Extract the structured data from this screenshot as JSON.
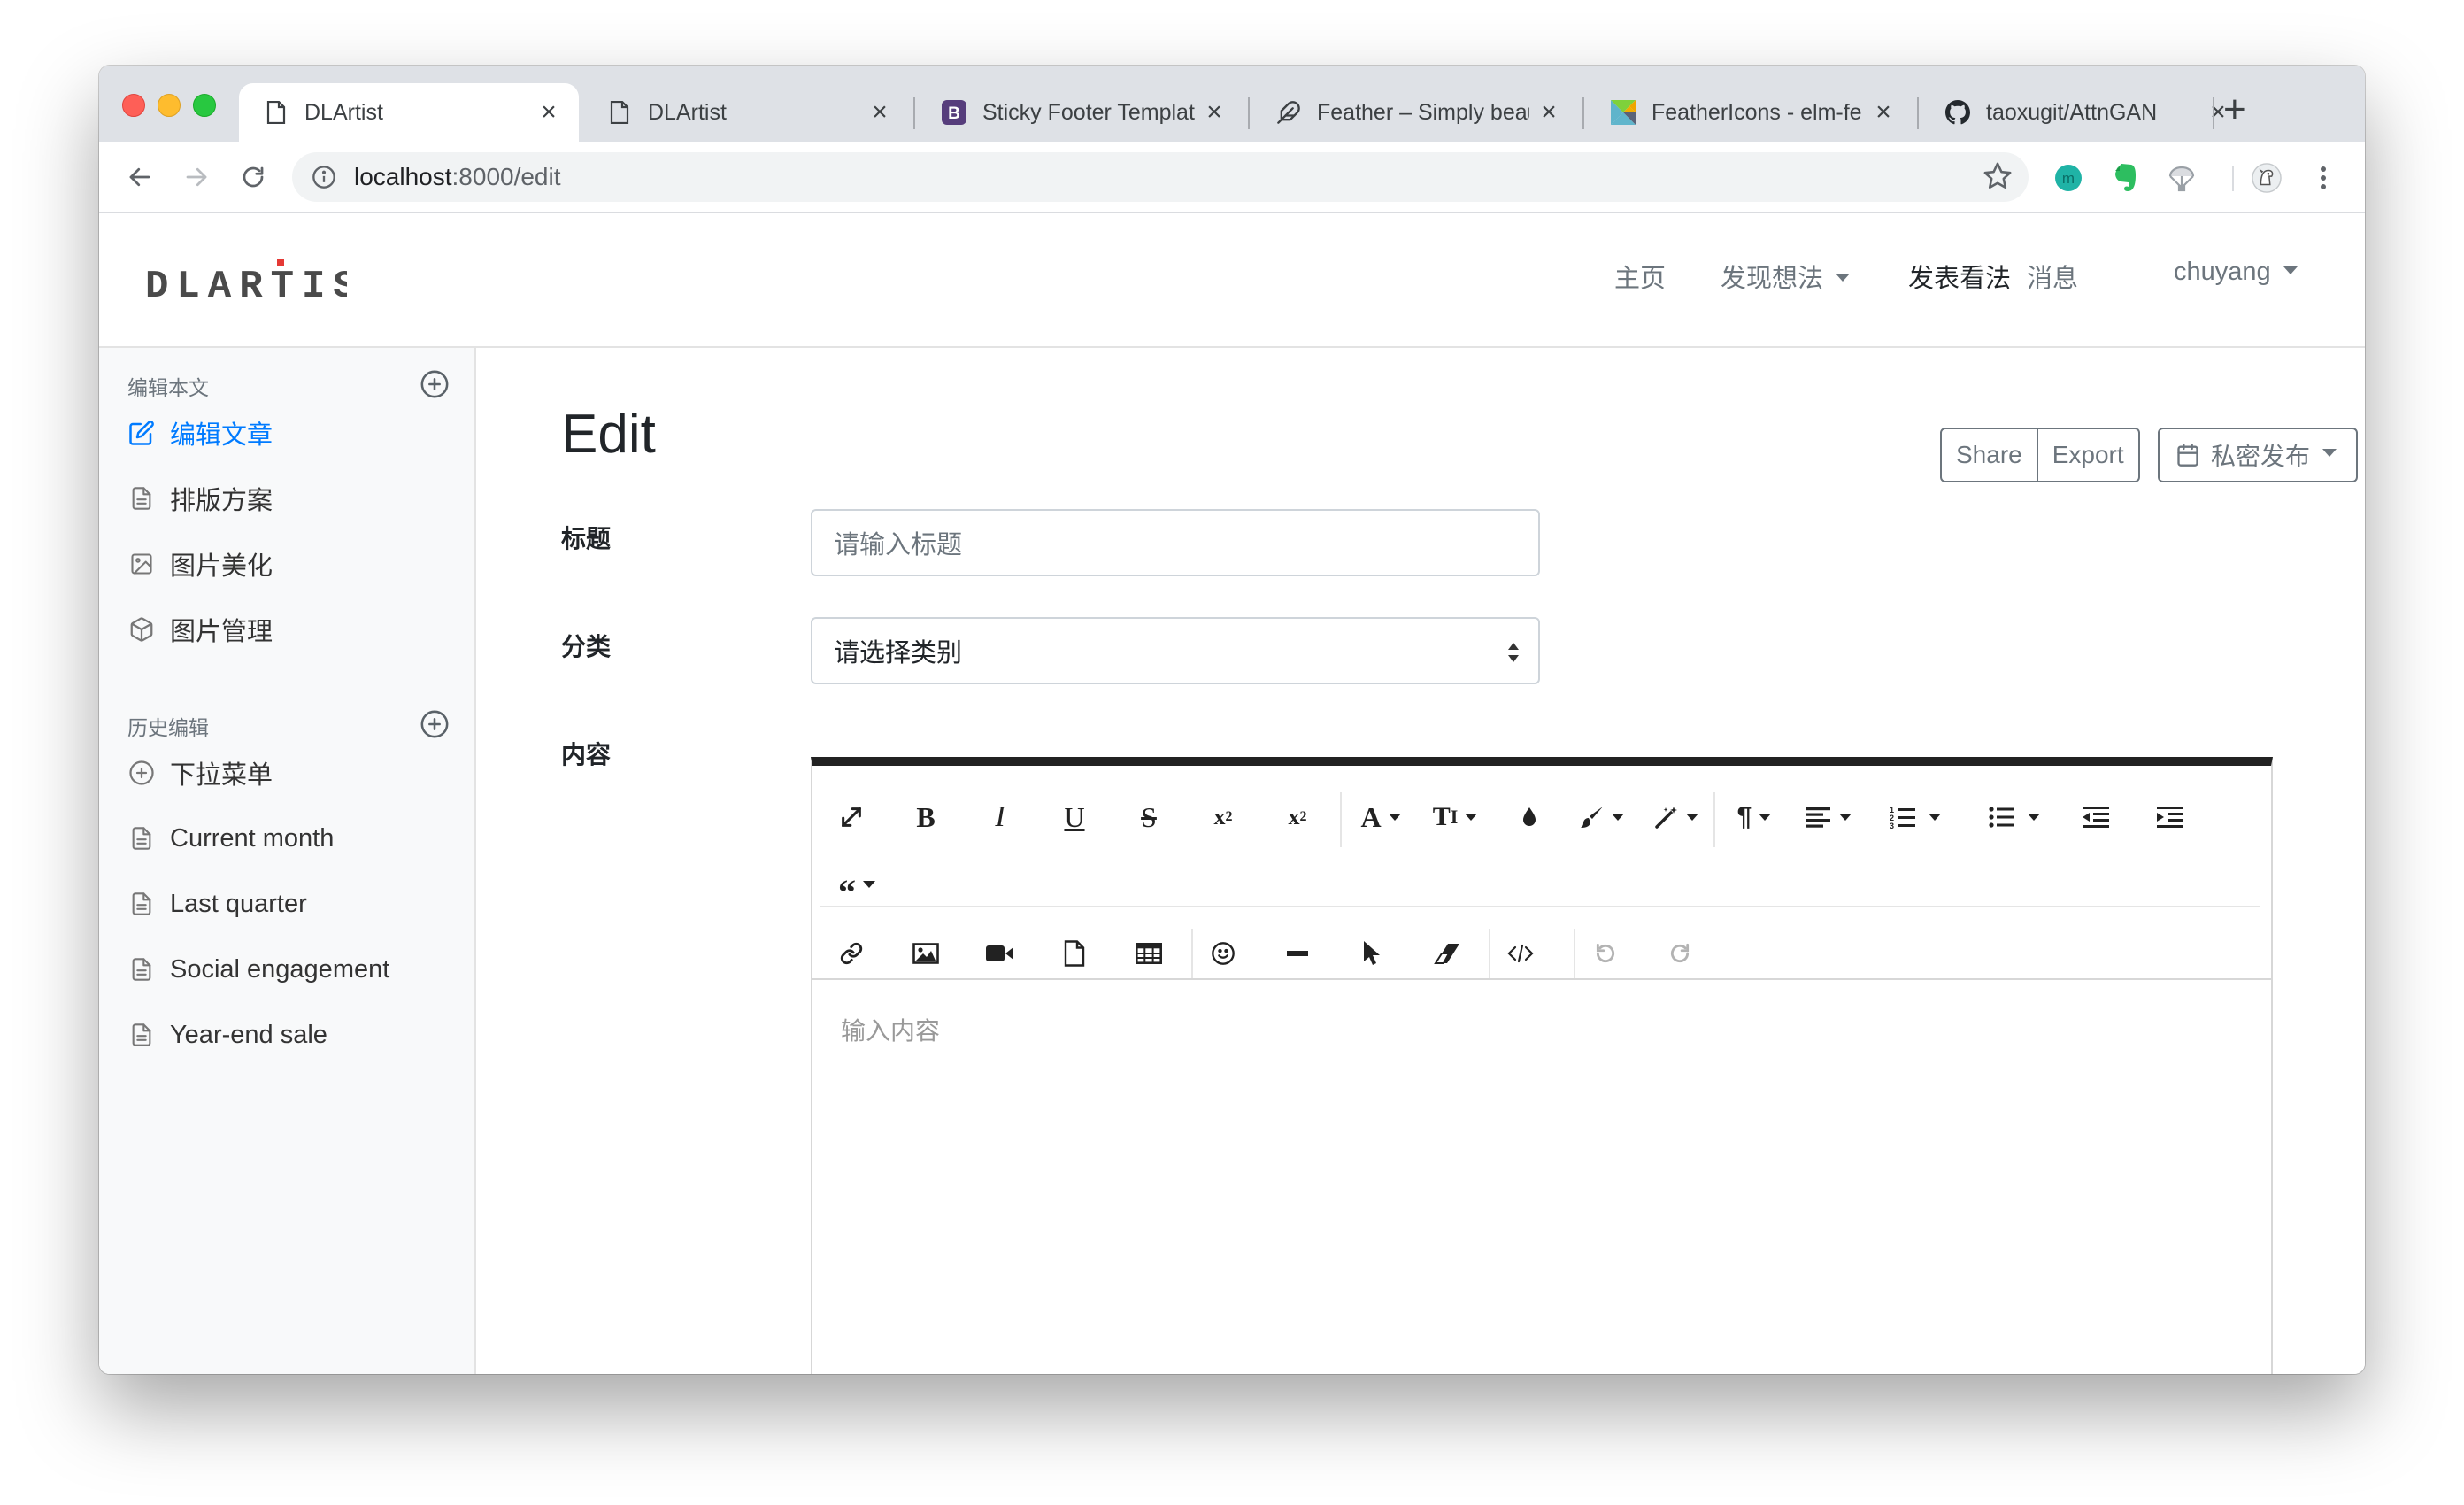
{
  "browser": {
    "tabs": [
      {
        "title": "DLArtist",
        "icon": "document-icon",
        "active": true
      },
      {
        "title": "DLArtist",
        "icon": "document-icon",
        "active": false
      },
      {
        "title": "Sticky Footer Templat",
        "icon": "bootstrap-icon",
        "active": false
      },
      {
        "title": "Feather – Simply beau",
        "icon": "feather-icon",
        "active": false
      },
      {
        "title": "FeatherIcons - elm-fe",
        "icon": "elm-icon",
        "active": false
      },
      {
        "title": "taoxugit/AttnGAN",
        "icon": "github-icon",
        "active": false
      }
    ],
    "close_glyph": "×",
    "new_tab_glyph": "+",
    "url_host": "localhost",
    "url_path": ":8000/edit",
    "extensions": [
      "mendeley-icon",
      "evernote-icon",
      "parachute-icon",
      "profile-avatar-icon",
      "more-vertical-icon"
    ]
  },
  "navbar": {
    "brand": "DLARTIST",
    "links": [
      {
        "label": "主页",
        "dropdown": false,
        "active": false
      },
      {
        "label": "发现想法",
        "dropdown": true,
        "active": false
      },
      {
        "label": "发表看法",
        "dropdown": false,
        "active": true
      },
      {
        "label": "消息",
        "dropdown": false,
        "active": false
      },
      {
        "label": "chuyang",
        "dropdown": true,
        "active": false
      }
    ]
  },
  "sidebar": {
    "section1": {
      "heading": "编辑本文",
      "items": [
        {
          "label": "编辑文章",
          "icon": "edit-icon",
          "active": true
        },
        {
          "label": "排版方案",
          "icon": "file-text-icon",
          "active": false
        },
        {
          "label": "图片美化",
          "icon": "image-icon",
          "active": false
        },
        {
          "label": "图片管理",
          "icon": "box-icon",
          "active": false
        }
      ]
    },
    "section2": {
      "heading": "历史编辑",
      "items": [
        {
          "label": "下拉菜单",
          "icon": "plus-circle-icon"
        },
        {
          "label": "Current month",
          "icon": "file-text-icon"
        },
        {
          "label": "Last quarter",
          "icon": "file-text-icon"
        },
        {
          "label": "Social engagement",
          "icon": "file-text-icon"
        },
        {
          "label": "Year-end sale",
          "icon": "file-text-icon"
        }
      ]
    }
  },
  "main": {
    "title": "Edit",
    "share_label": "Share",
    "export_label": "Export",
    "publish_label": "私密发布",
    "form": {
      "title_label": "标题",
      "title_placeholder": "请输入标题",
      "category_label": "分类",
      "category_value": "请选择类别",
      "content_label": "内容",
      "content_placeholder": "输入内容"
    }
  },
  "editor_toolbar": {
    "row1": [
      "fullscreen-icon",
      "bold-icon",
      "italic-icon",
      "underline-icon",
      "strikethrough-icon",
      "subscript-icon",
      "superscript-icon",
      "font-family-icon",
      "font-size-icon",
      "color-icon",
      "paint-brush-icon",
      "magic-icon",
      "paragraph-icon",
      "align-icon",
      "ordered-list-icon",
      "unordered-list-icon",
      "outdent-icon",
      "indent-icon"
    ],
    "row2": [
      "quote-icon"
    ],
    "row3": [
      "link-icon",
      "image-icon",
      "video-icon",
      "file-icon",
      "table-icon",
      "emoji-icon",
      "horizontal-rule-icon",
      "select-all-icon",
      "clear-format-icon",
      "code-view-icon",
      "undo-icon",
      "redo-icon"
    ]
  }
}
